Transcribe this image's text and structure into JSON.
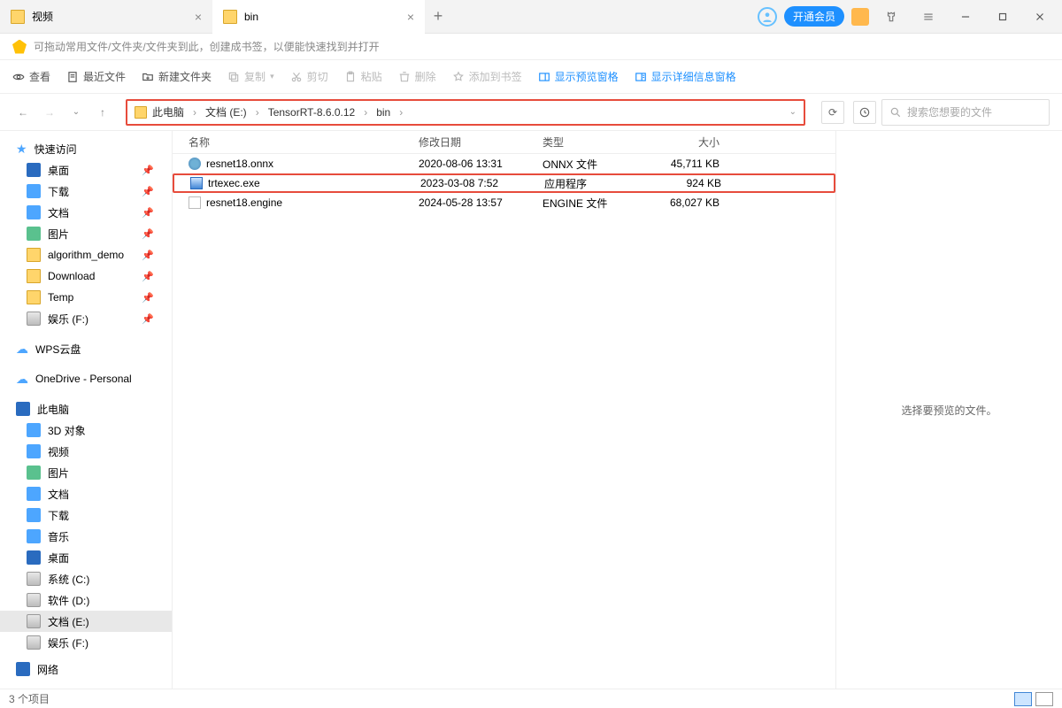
{
  "tabs": [
    {
      "title": "视频",
      "active": false
    },
    {
      "title": "bin",
      "active": true
    }
  ],
  "vip_button": "开通会员",
  "bookmark_hint": "可拖动常用文件/文件夹/文件夹到此，创建成书签，以便能快速找到并打开",
  "toolbar": {
    "view": "查看",
    "recent": "最近文件",
    "newfolder": "新建文件夹",
    "copy": "复制",
    "cut": "剪切",
    "paste": "粘贴",
    "delete": "删除",
    "bookmark": "添加到书签",
    "previewpane": "显示预览窗格",
    "detailpane": "显示详细信息窗格"
  },
  "breadcrumb": [
    "此电脑",
    "文档 (E:)",
    "TensorRT-8.6.0.12",
    "bin"
  ],
  "search_placeholder": "搜索您想要的文件",
  "sidebar": {
    "quick_access": "快速访问",
    "quick_items": [
      "桌面",
      "下载",
      "文档",
      "图片",
      "algorithm_demo",
      "Download",
      "Temp",
      "娱乐 (F:)"
    ],
    "wps_cloud": "WPS云盘",
    "onedrive": "OneDrive - Personal",
    "this_pc": "此电脑",
    "pc_items": [
      "3D 对象",
      "视频",
      "图片",
      "文档",
      "下载",
      "音乐",
      "桌面",
      "系统 (C:)",
      "软件 (D:)",
      "文档 (E:)",
      "娱乐 (F:)"
    ],
    "network": "网络"
  },
  "columns": {
    "name": "名称",
    "date": "修改日期",
    "type": "类型",
    "size": "大小"
  },
  "files": [
    {
      "name": "resnet18.onnx",
      "date": "2020-08-06 13:31",
      "type": "ONNX 文件",
      "size": "45,711 KB",
      "icon": "onnx",
      "hl": false
    },
    {
      "name": "trtexec.exe",
      "date": "2023-03-08 7:52",
      "type": "应用程序",
      "size": "924 KB",
      "icon": "exe",
      "hl": true
    },
    {
      "name": "resnet18.engine",
      "date": "2024-05-28 13:57",
      "type": "ENGINE 文件",
      "size": "68,027 KB",
      "icon": "engine",
      "hl": false
    }
  ],
  "preview_text": "选择要预览的文件。",
  "status": "3 个项目"
}
